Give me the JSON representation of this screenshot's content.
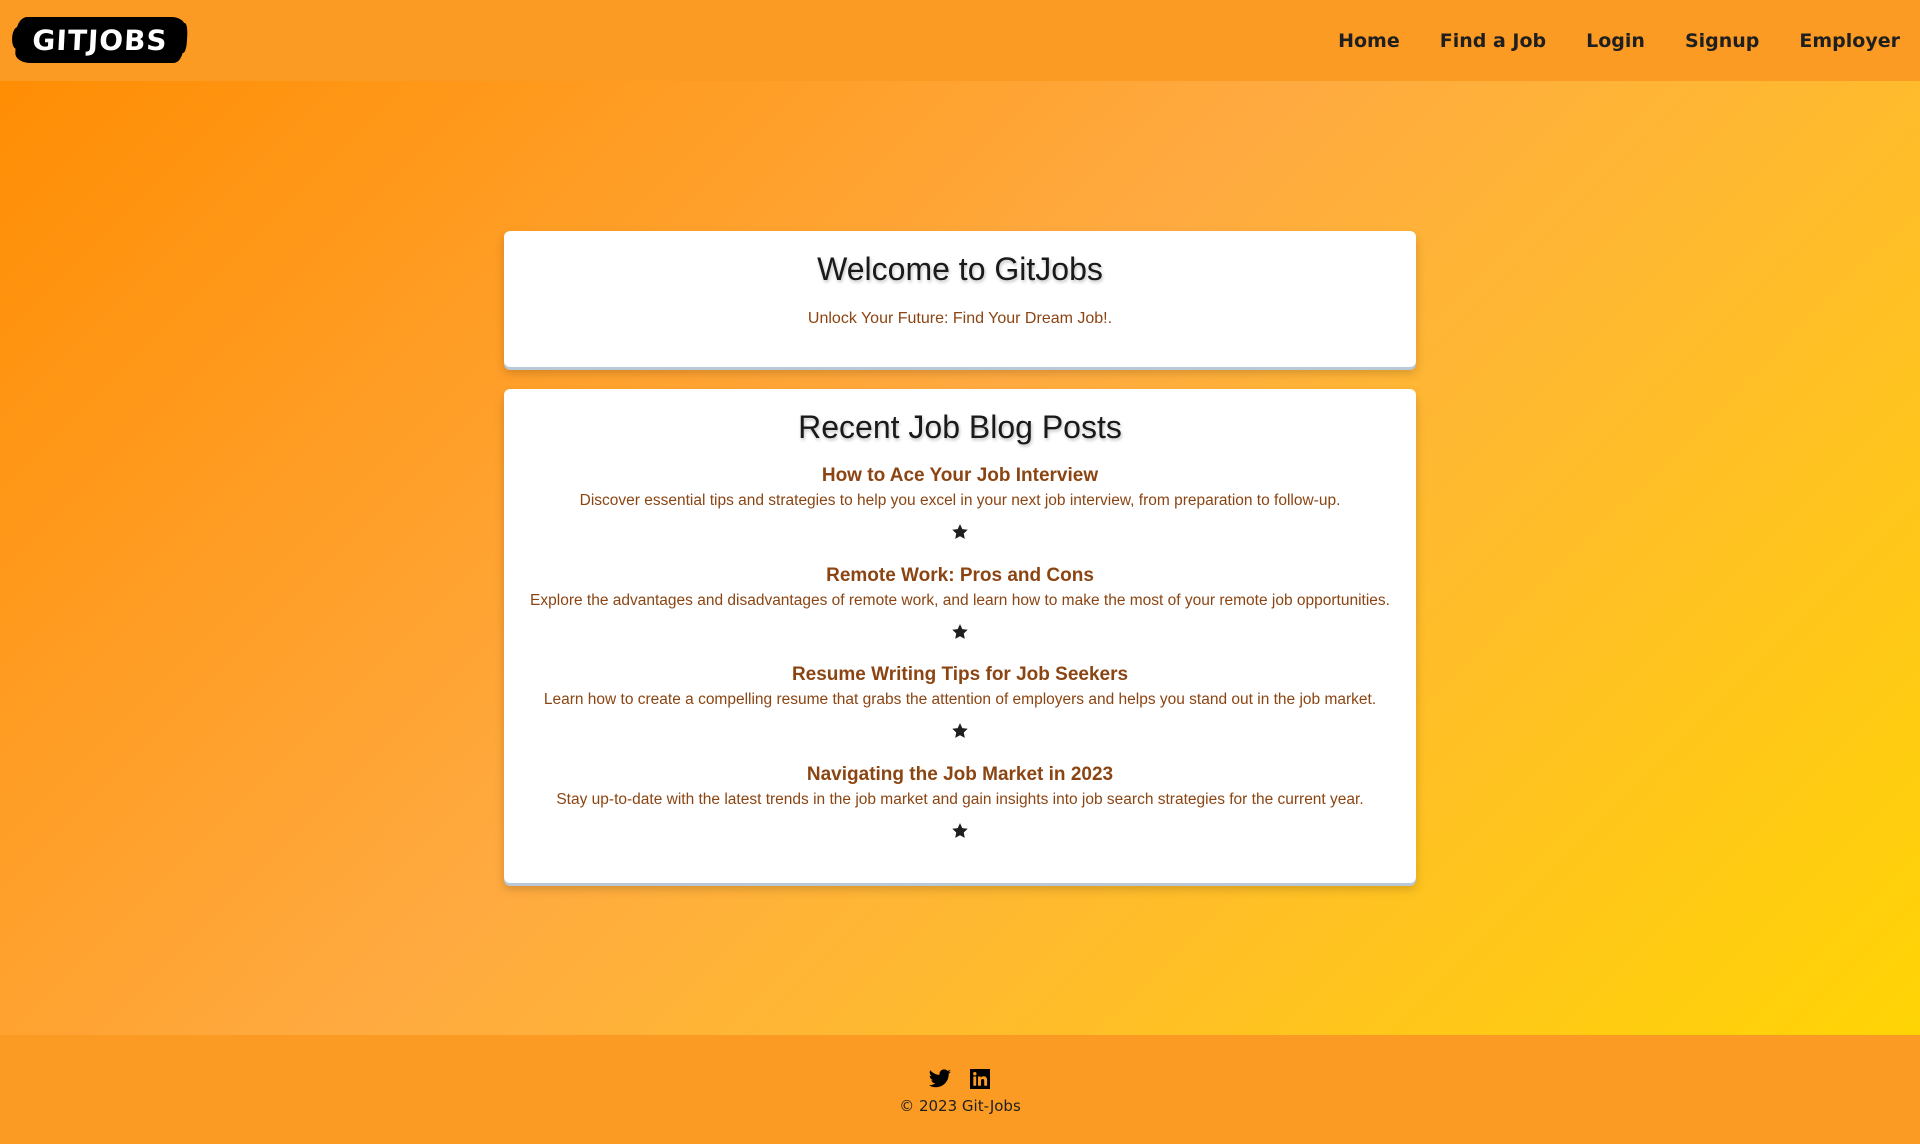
{
  "header": {
    "logo_text": "GITJOBS",
    "nav": [
      {
        "label": "Home"
      },
      {
        "label": "Find a Job"
      },
      {
        "label": "Login"
      },
      {
        "label": "Signup"
      },
      {
        "label": "Employer"
      }
    ]
  },
  "welcome": {
    "title": "Welcome to GitJobs",
    "tagline": "Unlock Your Future: Find Your Dream Job!."
  },
  "blog": {
    "title": "Recent Job Blog Posts",
    "posts": [
      {
        "title": "How to Ace Your Job Interview",
        "description": "Discover essential tips and strategies to help you excel in your next job interview, from preparation to follow-up.",
        "icon": "star-icon"
      },
      {
        "title": "Remote Work: Pros and Cons",
        "description": "Explore the advantages and disadvantages of remote work, and learn how to make the most of your remote job opportunities.",
        "icon": "star-icon"
      },
      {
        "title": "Resume Writing Tips for Job Seekers",
        "description": "Learn how to create a compelling resume that grabs the attention of employers and helps you stand out in the job market.",
        "icon": "star-icon"
      },
      {
        "title": "Navigating the Job Market in 2023",
        "description": "Stay up-to-date with the latest trends in the job market and gain insights into job search strategies for the current year.",
        "icon": "star-icon"
      }
    ]
  },
  "footer": {
    "social_icons": [
      "twitter-icon",
      "linkedin-icon"
    ],
    "copyright": "© 2023 Git-Jobs"
  },
  "colors": {
    "header_bg": "#fc9b23",
    "text_brown": "#8b4513",
    "gradient_start": "#ff8c00",
    "gradient_end": "#ffd700"
  }
}
